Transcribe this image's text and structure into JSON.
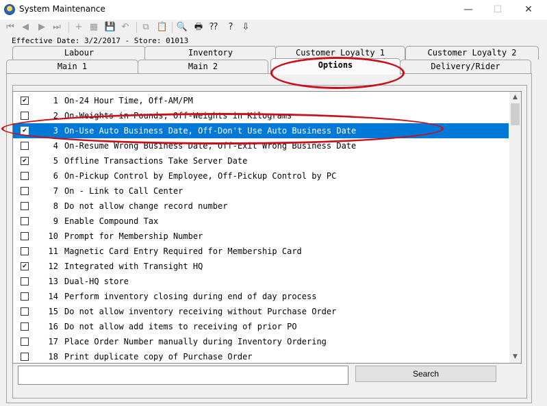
{
  "window": {
    "title": "System Maintenance",
    "minimize": "—",
    "maximize": "☐",
    "close": "✕"
  },
  "toolbar": [
    {
      "name": "first-record-icon",
      "glyph": "⏮",
      "active": false
    },
    {
      "name": "previous-record-icon",
      "glyph": "◀",
      "active": false
    },
    {
      "name": "next-record-icon",
      "glyph": "▶",
      "active": false
    },
    {
      "name": "last-record-icon",
      "glyph": "⏭",
      "active": false
    },
    {
      "name": "add-record-icon",
      "glyph": "+",
      "active": false
    },
    {
      "name": "edit-record-icon",
      "glyph": "▦",
      "active": false
    },
    {
      "name": "save-icon",
      "glyph": "💾",
      "active": false
    },
    {
      "name": "undo-icon",
      "glyph": "↶",
      "active": false
    },
    {
      "name": "copy-icon",
      "glyph": "⧉",
      "active": false
    },
    {
      "name": "paste-icon",
      "glyph": "📋",
      "active": false
    },
    {
      "name": "find-icon",
      "glyph": "🔍",
      "active": true
    },
    {
      "name": "print-icon",
      "glyph": "🖶",
      "active": true
    },
    {
      "name": "context-help-icon",
      "glyph": "⁇",
      "active": true
    },
    {
      "name": "help-icon",
      "glyph": "?",
      "active": true
    },
    {
      "name": "exit-icon",
      "glyph": "⇩",
      "active": true
    }
  ],
  "header": {
    "effective_date": "Effective Date: 3/2/2017 - Store: 01013"
  },
  "tabs_back": [
    "Labour",
    "Inventory",
    "Customer Loyalty 1",
    "Customer Loyalty 2"
  ],
  "tabs_front": [
    "Main 1",
    "Main 2",
    "Options",
    "Delivery/Rider"
  ],
  "active_tab": "Options",
  "options": [
    {
      "num": "1",
      "label": "On-24 Hour Time, Off-AM/PM",
      "checked": true
    },
    {
      "num": "2",
      "label": "On-Weights in Pounds, Off-Weights in Kilograms",
      "checked": false
    },
    {
      "num": "3",
      "label": "On-Use Auto Business Date, Off-Don't Use Auto Business Date",
      "checked": true,
      "selected": true
    },
    {
      "num": "4",
      "label": "On-Resume Wrong Business Date, Off-Exit Wrong Business Date",
      "checked": false
    },
    {
      "num": "5",
      "label": "Offline Transactions Take Server Date",
      "checked": true
    },
    {
      "num": "6",
      "label": "On-Pickup Control by Employee, Off-Pickup Control by PC",
      "checked": false
    },
    {
      "num": "7",
      "label": "On - Link to Call Center",
      "checked": false
    },
    {
      "num": "8",
      "label": "Do not allow change record number",
      "checked": false
    },
    {
      "num": "9",
      "label": "Enable Compound Tax",
      "checked": false
    },
    {
      "num": "10",
      "label": "Prompt for Membership Number",
      "checked": false
    },
    {
      "num": "11",
      "label": "Magnetic Card Entry Required for Membership Card",
      "checked": false
    },
    {
      "num": "12",
      "label": "Integrated with Transight HQ",
      "checked": true
    },
    {
      "num": "13",
      "label": "Dual-HQ store",
      "checked": false
    },
    {
      "num": "14",
      "label": "Perform inventory closing during end of day process",
      "checked": false
    },
    {
      "num": "15",
      "label": "Do not allow inventory receiving without Purchase Order",
      "checked": false
    },
    {
      "num": "16",
      "label": "Do not allow add items to receiving of prior PO",
      "checked": false
    },
    {
      "num": "17",
      "label": "Place Order Number manually during Inventory Ordering",
      "checked": false
    },
    {
      "num": "18",
      "label": "Print duplicate copy of Purchase Order",
      "checked": false
    }
  ],
  "search": {
    "value": "",
    "button_label": "Search"
  },
  "colors": {
    "selection": "#0078d7",
    "annotation": "#c8101a"
  }
}
